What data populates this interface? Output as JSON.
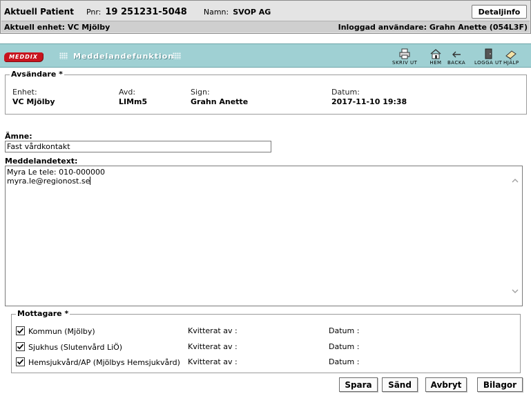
{
  "patient": {
    "title": "Aktuell Patient",
    "pnr_label": "Pnr:",
    "pnr_value": "19 251231-5048",
    "name_label": "Namn:",
    "name_value": "SVOP AG",
    "detail_button": "Detaljinfo",
    "unit_text": "Aktuell enhet: VC Mjölby",
    "user_text": "Inloggad användare: Grahn Anette (054L3F)"
  },
  "toolbar": {
    "logo": "MEDDIX",
    "title": "Meddelandefunktion",
    "buttons": [
      {
        "label": "SKRIV UT",
        "icon": "printer-icon"
      },
      {
        "label": "HEM",
        "icon": "home-icon"
      },
      {
        "label": "BACKA",
        "icon": "back-arrow-icon"
      },
      {
        "label": "LOGGA UT",
        "icon": "logout-door-icon"
      },
      {
        "label": "HJÄLP",
        "icon": "help-book-icon"
      }
    ]
  },
  "sender": {
    "legend": "Avsändare *",
    "fields": [
      {
        "label": "Enhet:",
        "value": "VC Mjölby"
      },
      {
        "label": "Avd:",
        "value": "LIMm5"
      },
      {
        "label": "Sign:",
        "value": "Grahn Anette"
      },
      {
        "label": "Datum:",
        "value": "2017-11-10 19:38"
      }
    ]
  },
  "subject": {
    "label": "Ämne:",
    "value": "Fast vårdkontakt"
  },
  "message": {
    "label": "Meddelandetext:",
    "lines": [
      "Myra Le tele: 010-000000",
      "myra.le@regionost.se"
    ]
  },
  "recipients": {
    "legend": "Mottagare *",
    "kvitterat_label": "Kvitterat av :",
    "datum_label": "Datum :",
    "items": [
      {
        "name": "Kommun (Mjölby)",
        "checked": true
      },
      {
        "name": "Sjukhus (Slutenvård LiÖ)",
        "checked": true
      },
      {
        "name": "Hemsjukvård/AP (Mjölbys Hemsjukvård)",
        "checked": true
      }
    ]
  },
  "actions": {
    "save": "Spara",
    "send": "Sänd",
    "cancel": "Avbryt",
    "attachments": "Bilagor"
  },
  "colors": {
    "toolbar_bg": "#9fd0d3",
    "logo_red": "#c8141e",
    "header_bg": "#e4e4e4"
  }
}
